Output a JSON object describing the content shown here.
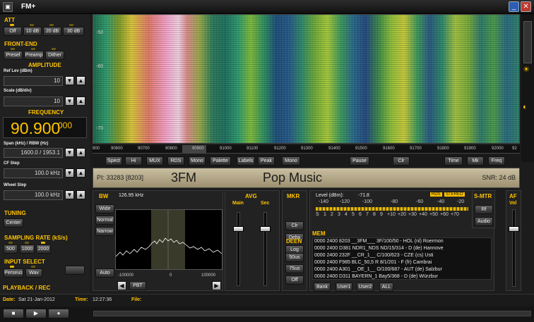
{
  "app": {
    "title": "FM+"
  },
  "att": {
    "label": "ATT",
    "buttons": [
      "Off",
      "10 dB",
      "20 dB",
      "30 dB"
    ]
  },
  "frontend": {
    "label": "FRONT-END",
    "buttons": [
      "Presel",
      "Preamp",
      "Dither"
    ]
  },
  "amplitude": {
    "label": "AMPLITUDE",
    "ref_label": "Ref Lev (dBm)",
    "ref_value": "10",
    "scale_label": "Scale (dB/div)",
    "scale_value": "10"
  },
  "frequency": {
    "label": "FREQUENCY",
    "value": "90.900",
    "sub": "000",
    "span_label": "Span (kHz) / RBW (Hz)",
    "span_value": "1600.0 / 1953.1",
    "cf_label": "CF Step",
    "cf_value": "100.0 kHz",
    "wheel_label": "Wheel Step",
    "wheel_value": "100.0 kHz"
  },
  "tuning": {
    "label": "TUNING",
    "center": "Center"
  },
  "sampling": {
    "label": "SAMPLING RATE (kS/s)",
    "buttons": [
      "500",
      "1000",
      "2000"
    ]
  },
  "input": {
    "label": "INPUT SELECT",
    "buttons": [
      "Perseus",
      "Wav"
    ]
  },
  "playback": {
    "label": "PLAYBACK / REC",
    "date_label": "Date:",
    "date": "Sat 21-Jan-2012",
    "time_label": "Time:",
    "time": "12:27:36",
    "file_label": "File:"
  },
  "waterfall": {
    "levels": [
      "-50",
      "-60",
      "-70"
    ],
    "scale": [
      "900",
      "90600",
      "90700",
      "90800",
      "90900",
      "91000",
      "91100",
      "91200",
      "91300",
      "91400",
      "91500",
      "91600",
      "91700",
      "91800",
      "91900",
      "92000",
      "92"
    ]
  },
  "controls": {
    "left": [
      "Spect",
      "Hi",
      "MUX",
      "RDS",
      "Mono",
      "Palette",
      "Labels",
      "Peak",
      "Mono"
    ],
    "right": [
      "Pause",
      "Clr",
      "Time",
      "Mk",
      "Freq"
    ]
  },
  "rds": {
    "pi": "PI: 33283 [8203]",
    "ps": "3FM",
    "rt": "Pop Music",
    "snr": "SNR: 24 dB"
  },
  "bw": {
    "label": "BW",
    "buttons": [
      "Wide",
      "Normal",
      "Narrow"
    ],
    "auto": "Auto",
    "value": "126.95 kHz",
    "ticks": [
      "-100000",
      "0",
      "100000"
    ],
    "pbt": "PBT"
  },
  "avg": {
    "label": "AVG",
    "main": "Main",
    "sec": "Sec"
  },
  "mkr": {
    "label": "MKR",
    "buttons": [
      "Clr",
      "Delta",
      "Log"
    ]
  },
  "deen": {
    "label": "DEEN",
    "buttons": [
      "50us",
      "75us",
      "Off"
    ]
  },
  "level": {
    "label": "Level (dBm):",
    "value": "-71.8",
    "rds": "RDS",
    "stereo": "STEREO",
    "dbm_scale": [
      "-140",
      "-120",
      "-100",
      "-80",
      "-60",
      "-40",
      "-20"
    ],
    "s_scale": [
      "S",
      "1",
      "2",
      "3",
      "4",
      "5",
      "6",
      "7",
      "8",
      "9",
      "+10",
      "+20",
      "+30",
      "+40",
      "+50",
      "+60",
      "+70"
    ]
  },
  "smtr": {
    "label": "S-MTR",
    "buttons": [
      "Rf",
      "Audio"
    ]
  },
  "af": {
    "label": "AF",
    "vol": "Vol"
  },
  "mem": {
    "label": "MEM",
    "lines": [
      "0000 2400 8203 __3FM___ 3F/100/50 - HOL (nl)  Roermon",
      "0000 2400 D381 NDR1_NDS ND/15/314 - D (de)  Hannove",
      "0000 2400 232F __CR_1__ C/100/623 - CZE (cs)  Usti",
      "0000 2400 F985 BLC_50,5 R 8/1/201 - F (fr)  Cambrai",
      "0000 2400 A301 __OE_1__ O/100/687 - AUT (de)  Salzbur",
      "0000 2400 D311 BAYERN_1 Bay5/368 - D (de)  Würzbur"
    ],
    "buttons": [
      "Bank",
      "User1",
      "User2",
      "ALL"
    ]
  }
}
